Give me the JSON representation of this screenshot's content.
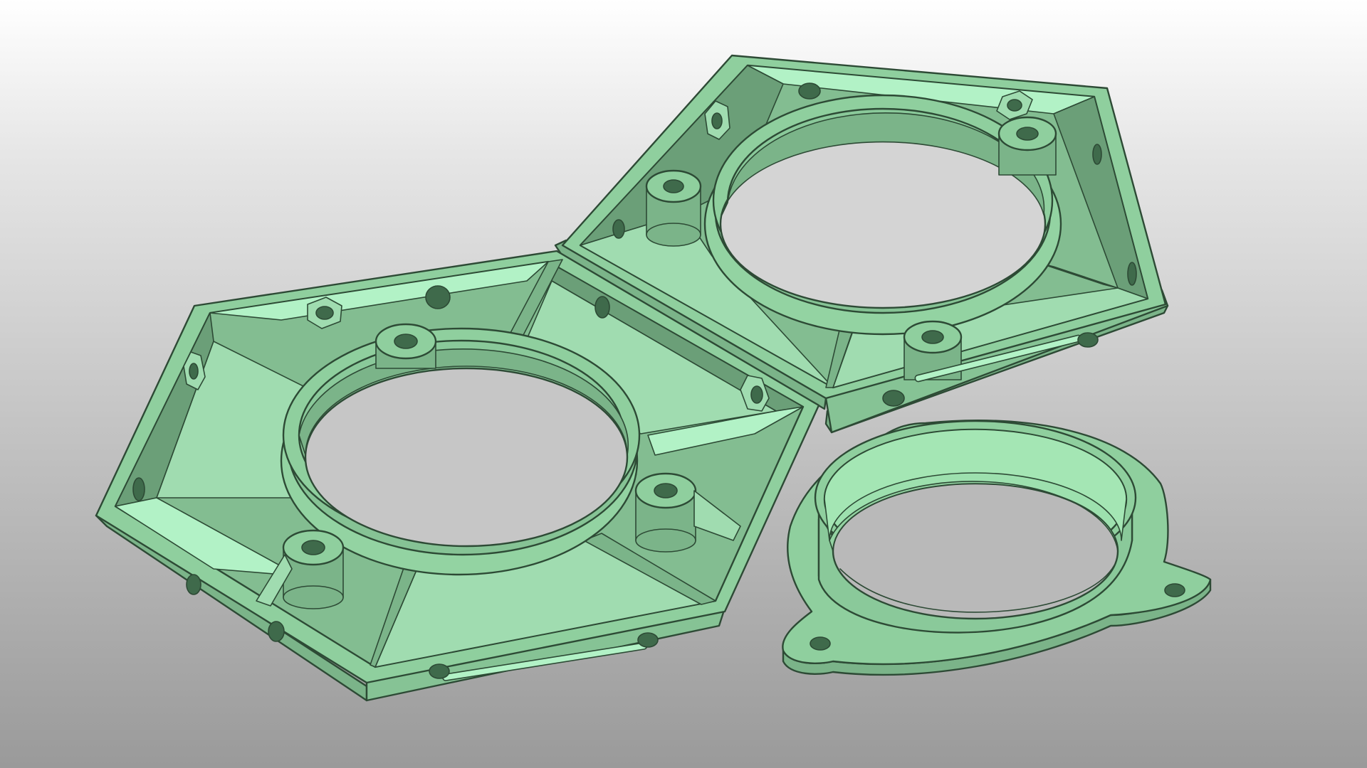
{
  "viewport": {
    "background_top": "#ffffff",
    "background_bottom": "#9a9a9a"
  },
  "model": {
    "parts": [
      {
        "name": "hexagonal-fan-housing-left",
        "color": "#8fcf9e"
      },
      {
        "name": "hexagonal-fan-housing-right",
        "color": "#8fcf9e"
      },
      {
        "name": "fan-duct-ring",
        "color": "#8fcf9e"
      }
    ],
    "colors": {
      "top_face": "#8fcf9e",
      "light_face": "#b2f2c6",
      "shade_face": "#7bb489",
      "dark_face": "#6b9f78",
      "edge": "#2d4a35"
    }
  }
}
